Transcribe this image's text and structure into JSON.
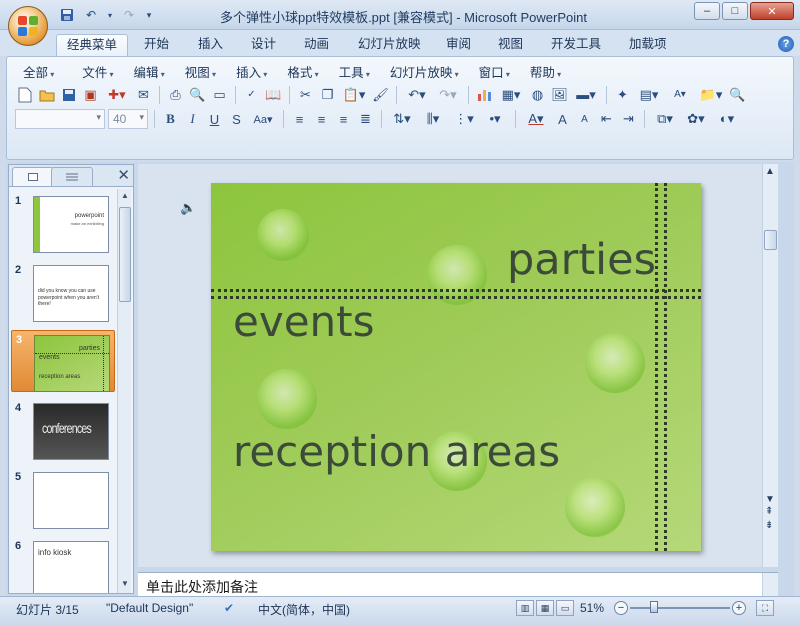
{
  "window": {
    "title": "多个弹性小球ppt特效模板.ppt [兼容模式] - Microsoft PowerPoint",
    "qat": {
      "save_icon": "save-icon",
      "undo_glyph": "↶",
      "redo_glyph": "↷",
      "customize_glyph": "▾"
    },
    "controls": {
      "minimize": "–",
      "maximize": "□",
      "close": "✕"
    }
  },
  "ribbon_tabs": [
    {
      "label": "经典菜单",
      "active": true
    },
    {
      "label": "开始"
    },
    {
      "label": "插入"
    },
    {
      "label": "设计"
    },
    {
      "label": "动画"
    },
    {
      "label": "幻灯片放映"
    },
    {
      "label": "审阅"
    },
    {
      "label": "视图"
    },
    {
      "label": "开发工具"
    },
    {
      "label": "加载项"
    }
  ],
  "help_label": "?",
  "menu": [
    "全部",
    "文件",
    "编辑",
    "视图",
    "插入",
    "格式",
    "工具",
    "幻灯片放映",
    "窗口",
    "帮助"
  ],
  "font": {
    "size": "40"
  },
  "panel": {
    "close_glyph": "✕"
  },
  "slides": [
    {
      "num": "1",
      "lines": [
        "powerpoint",
        "make an exhibiting"
      ]
    },
    {
      "num": "2",
      "lines": [
        "did you know you can use",
        "powerpoint when you aren't there!"
      ]
    },
    {
      "num": "3",
      "lines": [
        "parties",
        "events",
        "reception areas"
      ],
      "selected": true
    },
    {
      "num": "4",
      "lines": [
        "conferences"
      ]
    },
    {
      "num": "5",
      "lines": []
    },
    {
      "num": "6",
      "lines": [
        "info kiosk"
      ]
    }
  ],
  "current_slide": {
    "text_parties": "parties",
    "text_events": "events",
    "text_reception": "reception areas"
  },
  "notes_placeholder": "单击此处添加备注",
  "status": {
    "slide_counter": "幻灯片 3/15",
    "theme": "\"Default Design\"",
    "language": "中文(简体，中国)",
    "zoom": "51%"
  },
  "colors": {
    "slide_green": "#8dc53d",
    "slide_text": "#3c4a3a",
    "selected_thumb": "#e08a35"
  }
}
